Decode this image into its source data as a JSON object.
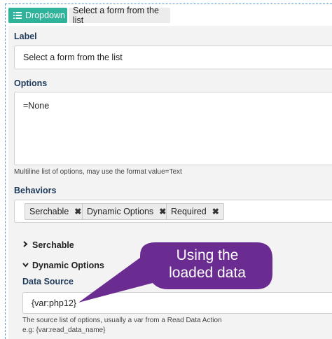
{
  "header": {
    "type_label": "Dropdown",
    "type_icon": "list-icon",
    "field_title": "Select a form from the list",
    "accent_color": "#2fb39a"
  },
  "label_field": {
    "label": "Label",
    "value": "Select a form from the list"
  },
  "options_field": {
    "label": "Options",
    "value": "=None",
    "help": "Multiline list of options, may use the format value=Text"
  },
  "behaviors": {
    "label": "Behaviors",
    "tags": [
      {
        "label": "Serchable"
      },
      {
        "label": "Dynamic Options"
      },
      {
        "label": "Required"
      }
    ],
    "remove_glyph": "✖"
  },
  "sections": {
    "serchable": {
      "label": "Serchable",
      "expanded": false
    },
    "dynamic_options": {
      "label": "Dynamic Options",
      "expanded": true
    }
  },
  "data_source": {
    "label": "Data Source",
    "value": "{var:php12}",
    "help_line1": "The source list of options, usually a var from a Read Data Action",
    "help_line2": "e.g: {var:read_data_name}"
  },
  "callout": {
    "line1": "Using the",
    "line2": "loaded data",
    "color": "#6b2c91"
  }
}
